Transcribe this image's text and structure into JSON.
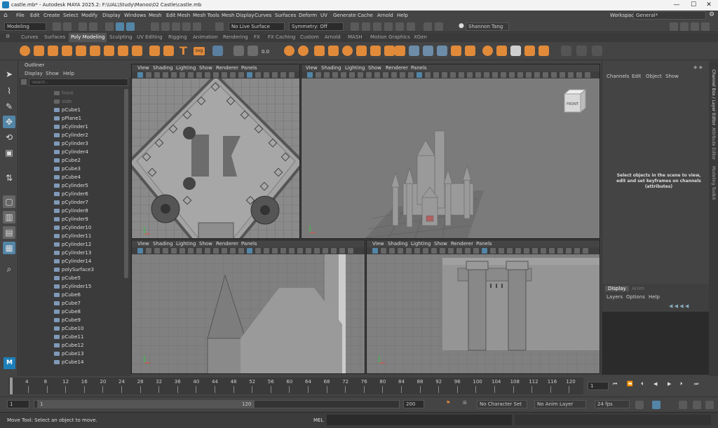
{
  "window": {
    "title": "castle.mb* - Autodesk MAYA 2025.2: F:\\UAL\\Study\\Manos\\02 Castle\\castle.mb",
    "min": "—",
    "max": "☐",
    "close": "✕"
  },
  "menus": [
    "File",
    "Edit",
    "Create",
    "Select",
    "Modify",
    "Display",
    "Windows",
    "Mesh",
    "Edit Mesh",
    "Mesh Tools",
    "Mesh Display",
    "Curves",
    "Surfaces",
    "Deform",
    "UV",
    "Generate",
    "Cache",
    "Arnold",
    "Help"
  ],
  "workspace": {
    "label": "Workspace:",
    "value": "General*"
  },
  "statusline": {
    "mode": "Modeling",
    "live_surface": "No Live Surface",
    "symmetry": "Symmetry: Off",
    "user": "Shannon Tang"
  },
  "shelf_tabs": [
    "Curves",
    "Surfaces",
    "Poly Modeling",
    "Sculpting",
    "UV Editing",
    "Rigging",
    "Animation",
    "Rendering",
    "FX",
    "FX Caching",
    "Custom",
    "Arnold",
    "MASH",
    "Motion Graphics",
    "XGen"
  ],
  "shelf_active": "Poly Modeling",
  "shelf_value": "0.0",
  "shelf_svg": "svg",
  "outliner": {
    "title": "Outliner",
    "menu": [
      "Display",
      "Show",
      "Help"
    ],
    "search_placeholder": "Search...",
    "items": [
      "front",
      "side",
      "pCube1",
      "pPlane1",
      "pCylinder1",
      "pCylinder2",
      "pCylinder3",
      "pCylinder4",
      "pCube2",
      "pCube3",
      "pCube4",
      "pCylinder5",
      "pCylinder6",
      "pCylinder7",
      "pCylinder8",
      "pCylinder9",
      "pCylinder10",
      "pCylinder11",
      "pCylinder12",
      "pCylinder13",
      "pCylinder14",
      "polySurface3",
      "pCube5",
      "pCylinder15",
      "pCube6",
      "pCube7",
      "pCube8",
      "pCube9",
      "pCube10",
      "pCube11",
      "pCube12",
      "pCube13",
      "pCube14"
    ],
    "dim_items": [
      "front",
      "side"
    ]
  },
  "viewport_menu": [
    "View",
    "Shading",
    "Lighting",
    "Show",
    "Renderer",
    "Panels"
  ],
  "viewcube_label": "FRONT",
  "channel_box": {
    "menu": [
      "Channels",
      "Edit",
      "Object",
      "Show"
    ],
    "message": "Select objects in the scene to view, edit and set keyframes on channels (attributes)",
    "layer_tabs": [
      "Display",
      "Anim"
    ],
    "layer_menu": [
      "Layers",
      "Options",
      "Help"
    ]
  },
  "side_tabs": [
    "Channel Box / Layer Editor",
    "Attribute Editor",
    "Modeling Toolkit"
  ],
  "timeline": {
    "ticks": [
      "4",
      "8",
      "12",
      "16",
      "20",
      "24",
      "28",
      "32",
      "36",
      "40",
      "44",
      "48",
      "52",
      "56",
      "60",
      "64",
      "68",
      "72",
      "76",
      "80",
      "84",
      "88",
      "92",
      "96",
      "100",
      "104",
      "108",
      "112",
      "116",
      "120",
      "12"
    ],
    "current": "1"
  },
  "range": {
    "start": "1",
    "inner_start": "1",
    "inner_end": "120",
    "end": "200",
    "char_set": "No Character Set",
    "anim_layer": "No Anim Layer",
    "fps": "24 fps"
  },
  "help": {
    "text": "Move Tool: Select an object to move.",
    "mel": "MEL"
  }
}
